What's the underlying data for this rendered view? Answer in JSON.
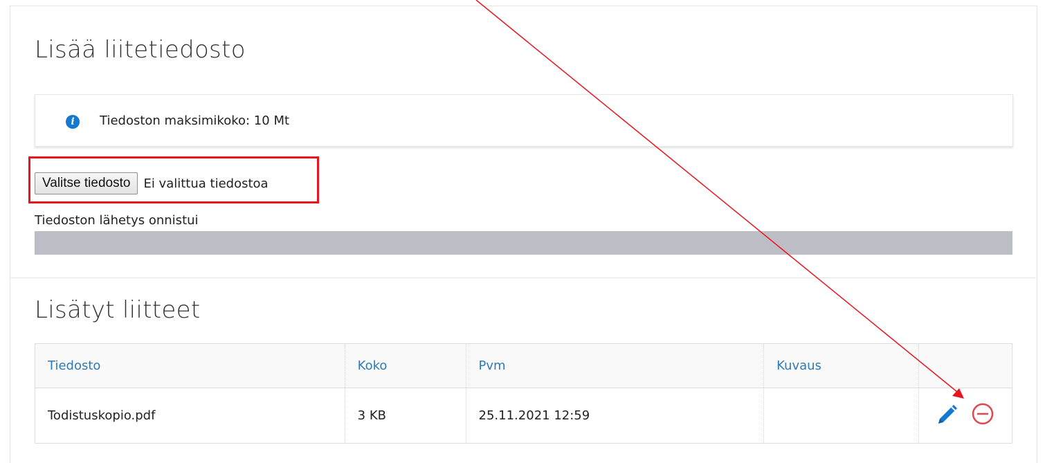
{
  "upload_section": {
    "title": "Lisää liitetiedosto",
    "info_text": "Tiedoston maksimikoko: 10 Mt",
    "info_icon": "info-icon",
    "file_button_label": "Valitse tiedosto",
    "file_status": "Ei valittua tiedostoa",
    "upload_message": "Tiedoston lähetys onnistui",
    "progress_fraction": 1.0
  },
  "attachments_section": {
    "title": "Lisätyt liitteet",
    "columns": [
      "Tiedosto",
      "Koko",
      "Pvm",
      "Kuvaus",
      ""
    ],
    "rows": [
      {
        "file": "Todistuskopio.pdf",
        "size": "3 KB",
        "date": "25.11.2021 12:59",
        "description": "",
        "actions": [
          "pencil-icon",
          "remove-circle-icon"
        ]
      }
    ]
  },
  "colors": {
    "link_blue": "#2d7bb6",
    "info_blue": "#1479d1",
    "highlight_red": "#e8141e",
    "progress_gray": "#bdbec5"
  }
}
